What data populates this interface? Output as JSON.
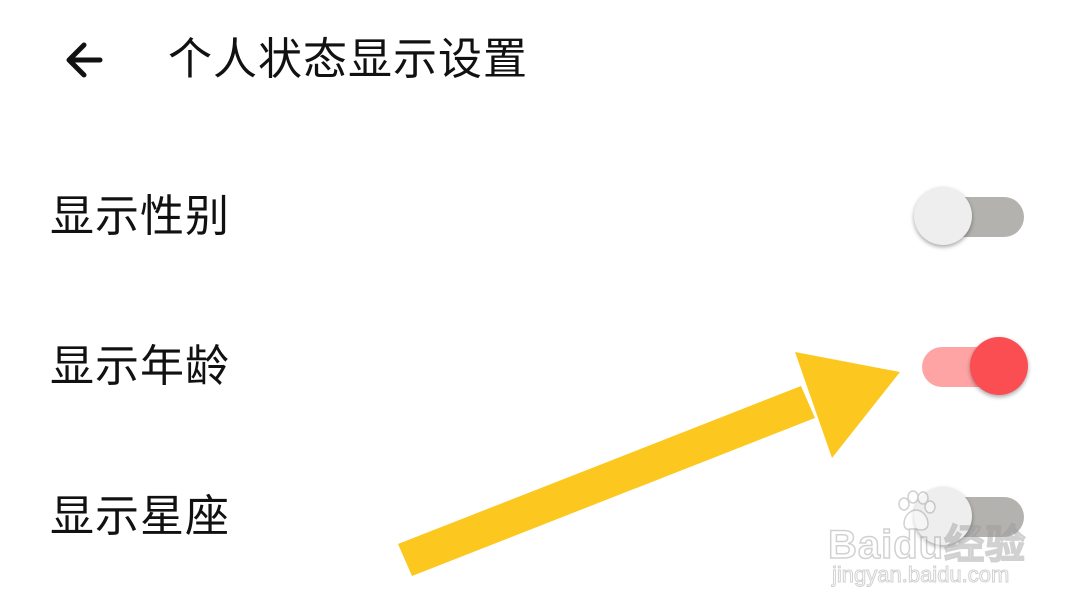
{
  "header": {
    "back_icon": "arrow-left-icon",
    "title": "个人状态显示设置"
  },
  "settings": [
    {
      "label": "显示性别",
      "enabled": false
    },
    {
      "label": "显示年龄",
      "enabled": true
    },
    {
      "label": "显示星座",
      "enabled": false
    }
  ],
  "colors": {
    "toggle_on_track": "#ffa4a4",
    "toggle_on_knob": "#fb4e53",
    "toggle_off_track": "#b4b2af",
    "toggle_off_knob": "#eeeeee",
    "annotation_arrow": "#fcc81f"
  },
  "annotation": {
    "icon": "annotation-arrow-icon"
  },
  "watermark": {
    "brand": "Baidu经验",
    "url": "jingyan.baidu.com",
    "icon": "baidu-paw-icon"
  }
}
